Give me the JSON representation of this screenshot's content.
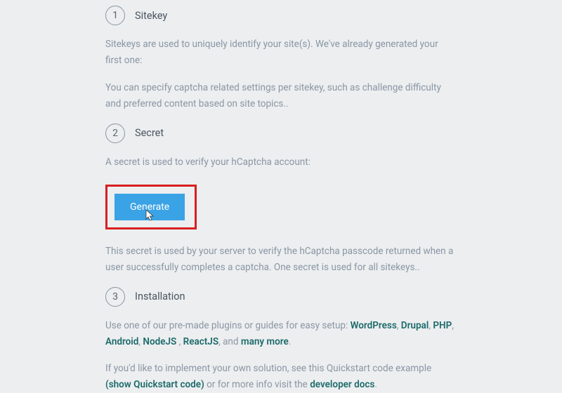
{
  "steps": {
    "s1": {
      "num": "1",
      "title": "Sitekey",
      "p1": "Sitekeys are used to uniquely identify your site(s). We've already generated your first one:",
      "p2": "You can specify captcha related settings per sitekey, such as challenge difficulty and preferred content based on site topics.."
    },
    "s2": {
      "num": "2",
      "title": "Secret",
      "p1": "A secret is used to verify your hCaptcha account:",
      "button": "Generate",
      "p2": "This secret is used by your server to verify the hCaptcha passcode returned when a user successfully completes a captcha. One secret is used for all sitekeys.."
    },
    "s3": {
      "num": "3",
      "title": "Installation",
      "p1_a": "Use one of our pre-made plugins or guides for easy setup: ",
      "links": {
        "wordpress": "WordPress",
        "drupal": "Drupal",
        "php": "PHP",
        "android": "Android",
        "nodejs": "NodeJS",
        "reactjs": "ReactJS",
        "more": "many more"
      },
      "p1_comma": ", ",
      "p1_and": ", and ",
      "p1_end": ".",
      "p2_a": "If you'd like to implement your own solution, see this Quickstart code example ",
      "p2_show": "(show Quickstart code)",
      "p2_b": " or for more info visit the ",
      "p2_docs": "developer docs",
      "p2_end": "."
    }
  }
}
